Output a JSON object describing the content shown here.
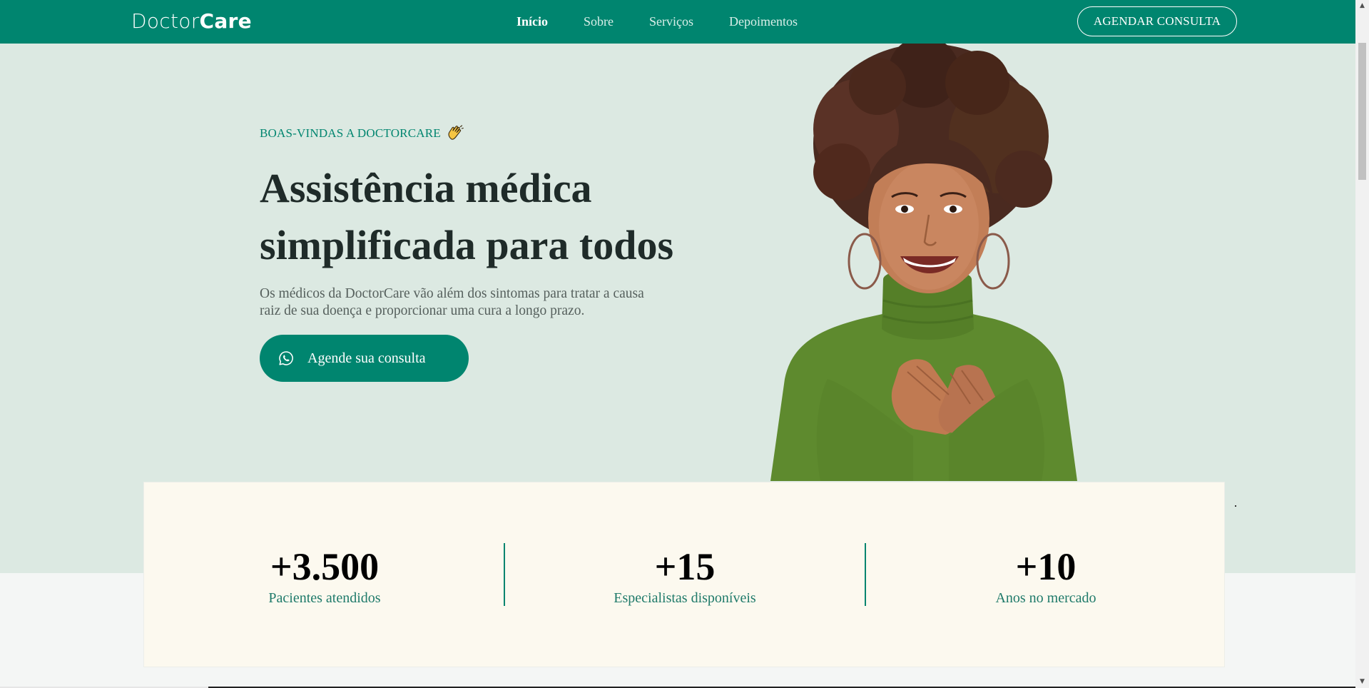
{
  "nav": {
    "logo_light": "Doctor",
    "logo_strong": "Care",
    "links": [
      "Início",
      "Sobre",
      "Serviços",
      "Depoimentos"
    ],
    "cta_label": "AGENDAR CONSULTA"
  },
  "hero": {
    "eyebrow": "BOAS-VINDAS A DOCTORCARE",
    "eyebrow_icon": "waving-hand-icon",
    "headline_line1": "Assistência médica",
    "headline_line2": "simplificada para todos",
    "lead_line1": "Os médicos da DoctorCare vão além dos sintomas para tratar a causa",
    "lead_line2": "raiz de sua doença e proporcionar uma cura a longo prazo.",
    "cta_label": "Agende sua consulta",
    "cta_icon": "whatsapp-icon",
    "image": "smiling-woman-portrait"
  },
  "stats": [
    {
      "value": "+3.500",
      "label": "Pacientes atendidos"
    },
    {
      "value": "+15",
      "label": "Especialistas disponíveis"
    },
    {
      "value": "+10",
      "label": "Anos no mercado"
    }
  ],
  "colors": {
    "brand": "#00856f",
    "hero_bg": "#dce9e2",
    "stats_bg": "#fcf9ef",
    "heading": "#1f2b29"
  }
}
